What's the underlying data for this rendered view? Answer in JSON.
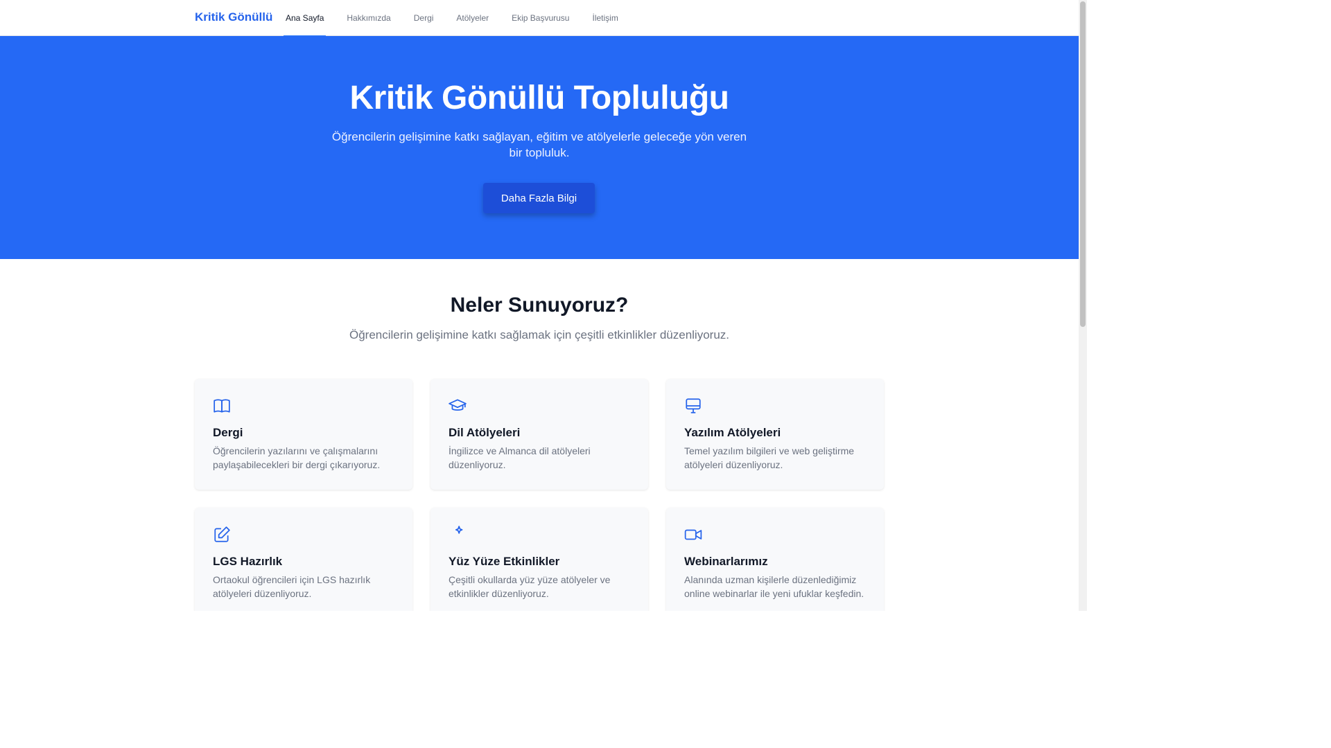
{
  "nav": {
    "brand": "Kritik Gönüllü",
    "items": [
      {
        "label": "Ana Sayfa",
        "active": true
      },
      {
        "label": "Hakkımızda",
        "active": false
      },
      {
        "label": "Dergi",
        "active": false
      },
      {
        "label": "Atölyeler",
        "active": false
      },
      {
        "label": "Ekip Başvurusu",
        "active": false
      },
      {
        "label": "İletişim",
        "active": false
      }
    ]
  },
  "hero": {
    "title": "Kritik Gönüllü Topluluğu",
    "subtitle": "Öğrencilerin gelişimine katkı sağlayan, eğitim ve atölyelerle geleceğe yön veren bir topluluk.",
    "button_label": "Daha Fazla Bilgi"
  },
  "services": {
    "title": "Neler Sunuyoruz?",
    "subtitle": "Öğrencilerin gelişimine katkı sağlamak için çeşitli etkinlikler düzenliyoruz.",
    "cards": [
      {
        "icon": "book-open-icon",
        "title": "Dergi",
        "description": "Öğrencilerin yazılarını ve çalışmalarını paylaşabilecekleri bir dergi çıkarıyoruz."
      },
      {
        "icon": "graduation-cap-icon",
        "title": "Dil Atölyeleri",
        "description": "İngilizce ve Almanca dil atölyeleri düzenliyoruz."
      },
      {
        "icon": "monitor-icon",
        "title": "Yazılım Atölyeleri",
        "description": "Temel yazılım bilgileri ve web geliştirme atölyeleri düzenliyoruz."
      },
      {
        "icon": "pencil-square-icon",
        "title": "LGS Hazırlık",
        "description": "Ortaokul öğrencileri için LGS hazırlık atölyeleri düzenliyoruz."
      },
      {
        "icon": "sparkle-icon",
        "title": "Yüz Yüze Etkinlikler",
        "description": "Çeşitli okullarda yüz yüze atölyeler ve etkinlikler düzenliyoruz."
      },
      {
        "icon": "video-camera-icon",
        "title": "Webinarlarımız",
        "description": "Alanında uzman kişilerle düzenlediğimiz online webinarlar ile yeni ufuklar keşfedin."
      }
    ]
  },
  "colors": {
    "brand": "#2563eb",
    "hero_bg": "#2569f5",
    "button_bg": "#1d4ed8",
    "card_bg": "#f8f9fb"
  }
}
